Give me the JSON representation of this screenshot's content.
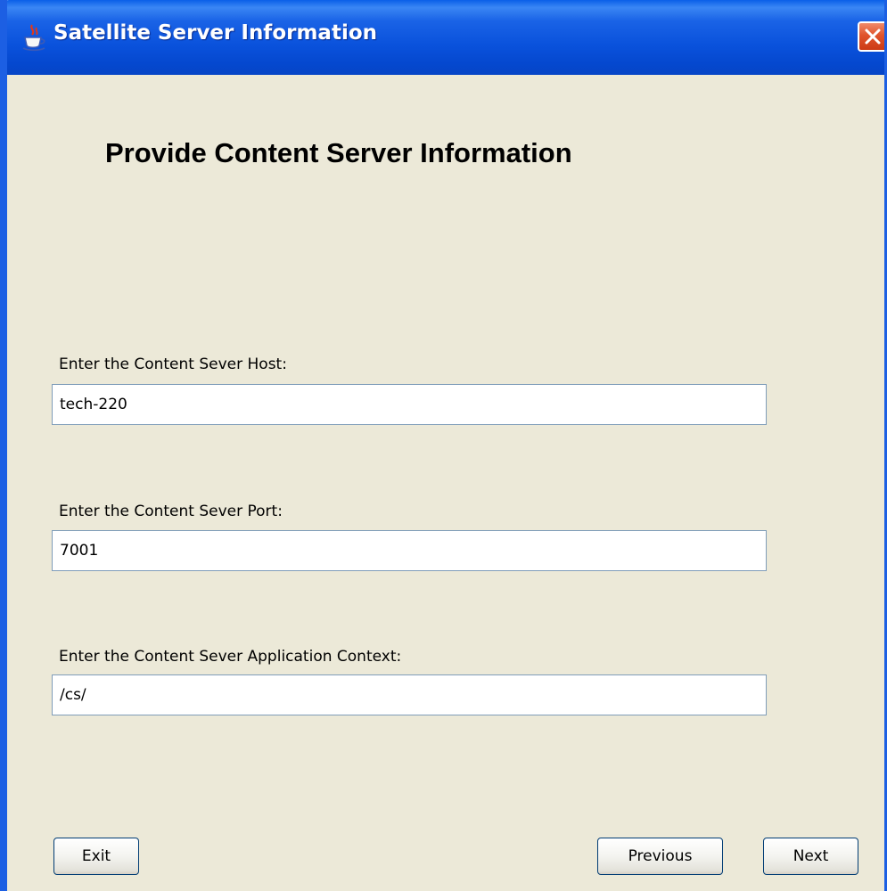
{
  "window": {
    "title": "Satellite Server Information",
    "icon": "java-cup-icon",
    "close_icon": "close-icon"
  },
  "page": {
    "heading": "Provide Content Server Information"
  },
  "fields": {
    "host": {
      "label": "Enter the Content Sever Host:",
      "value": "tech-220"
    },
    "port": {
      "label": "Enter the Content Sever Port:",
      "value": "7001"
    },
    "context": {
      "label": "Enter the Content Sever Application Context:",
      "value": "/cs/"
    }
  },
  "buttons": {
    "exit": "Exit",
    "previous": "Previous",
    "next": "Next"
  },
  "colors": {
    "titlebar": "#0a52dc",
    "window_body": "#ece9d8",
    "close_button": "#e0542c",
    "input_border": "#7f9db9"
  }
}
